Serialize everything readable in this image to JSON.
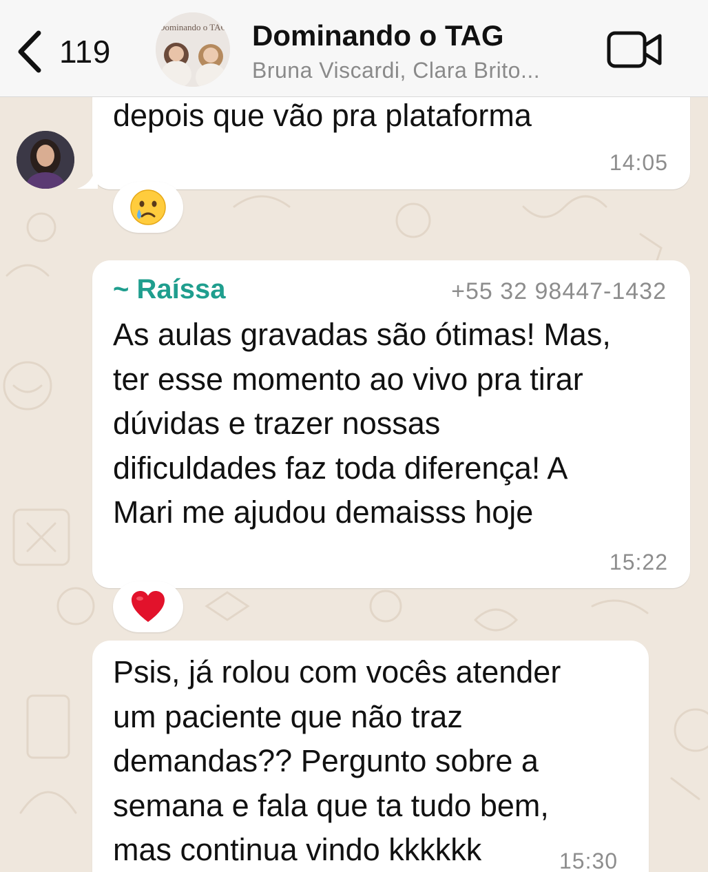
{
  "header": {
    "back_count": "119",
    "group_title": "Dominando o TAG",
    "group_subtitle": "Bruna Viscardi, Clara Brito...",
    "avatar_text": "Dominando o TAG"
  },
  "messages": [
    {
      "text_lines": [
        "depois que vão pra plataforma"
      ],
      "time": "14:05",
      "reaction": "😢"
    },
    {
      "sender_name": "~ Raíssa",
      "sender_phone": "+55 32 98447-1432",
      "text_lines": [
        "As aulas gravadas são ótimas! Mas,",
        "ter esse momento ao vivo pra tirar",
        "dúvidas e trazer nossas",
        "dificuldades faz toda diferença! A",
        "Mari me ajudou demaisss hoje"
      ],
      "time": "15:22",
      "reaction": "❤️"
    },
    {
      "text_lines": [
        "Psis, já rolou com vocês atender",
        "um paciente que não traz",
        "demandas?? Pergunto sobre a",
        "semana e fala que ta tudo bem,",
        "mas continua vindo kkkkkk"
      ],
      "time": "15:30"
    }
  ],
  "colors": {
    "sender_name": "#1f9e8e",
    "wallpaper": "#efe7dd",
    "bubble": "#ffffff"
  }
}
